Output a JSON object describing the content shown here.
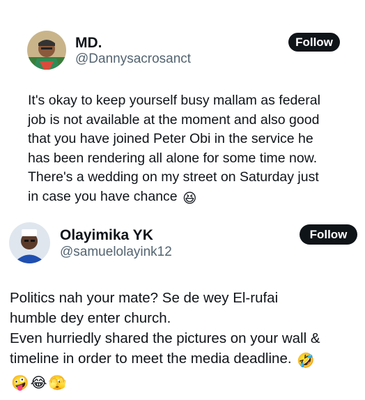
{
  "tweet1": {
    "name": "MD.",
    "handle": "@Dannysacrosanct",
    "follow_label": "Follow",
    "text": "It's okay to keep yourself busy mallam as federal\njob is not available at the moment and also good\nthat you have joined Peter Obi in the service he\nhas been rendering all alone for some time now.\nThere's a wedding on my street on Saturday just\nin case you have chance",
    "emoji": "😆"
  },
  "tweet2": {
    "name": "Olayimika YK",
    "handle": "@samuelolayink12",
    "follow_label": "Follow",
    "text": "Politics nah your mate? Se de wey El-rufai\nhumble dey enter church.\nEven hurriedly shared the pictures on your wall &\ntimeline in order to meet the media deadline.",
    "emoji_inline": "🤣",
    "emoji_line": [
      "🤪",
      "😂",
      "🫣"
    ]
  },
  "colors": {
    "button_bg": "#0f1419",
    "handle": "#536471",
    "text": "#0f1419"
  }
}
